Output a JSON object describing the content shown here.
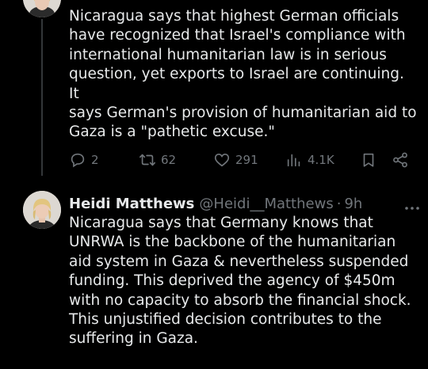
{
  "tweet1": {
    "text": "Nicaragua says that highest German officials\nhave recognized that Israel's compliance with\ninternational humanitarian law is in serious\nquestion, yet exports to Israel are continuing. It\nsays German's provision of humanitarian aid to\nGaza is a \"pathetic excuse.\"",
    "replies": "2",
    "reposts": "62",
    "likes": "291",
    "views": "4.1K"
  },
  "tweet2": {
    "display_name": "Heidi Matthews",
    "handle": "@Heidi__Matthews",
    "separator": "·",
    "time": "9h",
    "text": "Nicaragua says that Germany knows that\nUNRWA is the backbone of the humanitarian\naid system in Gaza & nevertheless suspended\nfunding. This deprived the agency of $450m\nwith no capacity to absorb the financial shock.\nThis unjustified decision contributes to the\nsuffering in Gaza."
  },
  "icons": {
    "reply": "reply-icon",
    "repost": "repost-icon",
    "like": "heart-icon",
    "views": "views-icon",
    "bookmark": "bookmark-icon",
    "share": "share-icon",
    "more": "more-icon"
  },
  "colors": {
    "background": "#000000",
    "text": "#e7e9ea",
    "muted": "#71767b",
    "thread_line": "#333639"
  }
}
